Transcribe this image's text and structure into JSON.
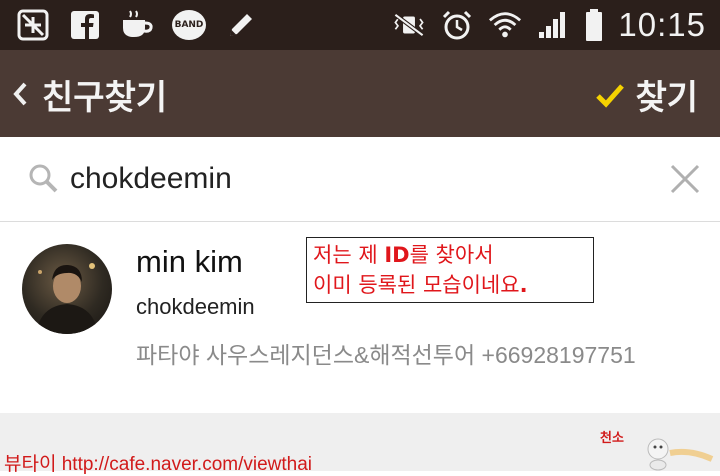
{
  "status_bar": {
    "icons_left": [
      "airplane-off-icon",
      "facebook-icon",
      "coffee-cup-icon",
      "band-app-icon",
      "pencil-icon"
    ],
    "band_label": "BAND",
    "icons_right": [
      "vibrate-mute-icon",
      "alarm-icon",
      "wifi-icon",
      "signal-icon",
      "battery-icon"
    ],
    "time": "10:15"
  },
  "header": {
    "back_icon": "chevron-left-icon",
    "title": "친구찾기",
    "find_label": "찾기",
    "check_color": "#f5d200"
  },
  "search": {
    "value": "chokdeemin",
    "clear_icon": "close-icon"
  },
  "result": {
    "name": "min kim",
    "id": "chokdeemin",
    "status": "파타야 사우스레지던스&해적선투어 +66928197751"
  },
  "annotation": {
    "line1_a": "저는 제 ",
    "line1_b": "ID",
    "line1_c": "를 찾아서",
    "line2_a": "이미 등록된 모습이네요",
    "line2_b": "."
  },
  "footer": {
    "text": "뷰타이 http://cafe.naver.com/viewthai",
    "logo_label": "천소"
  },
  "colors": {
    "status_bar": "#2b1f1b",
    "title_bar": "#4b3a34",
    "annotation_text": "#e0161b"
  }
}
